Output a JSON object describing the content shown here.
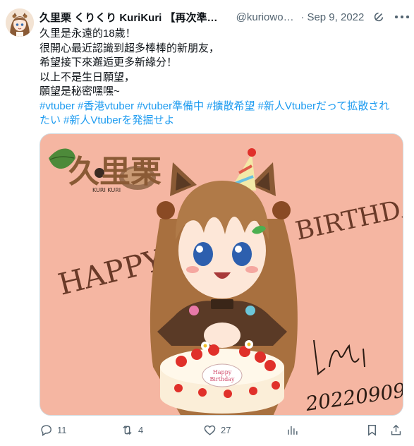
{
  "tweet": {
    "display_name": "久里栗 くりくり KuriKuri 【再次準備…",
    "handle": "@kuriowok…",
    "separator": "·",
    "date": "Sep 9, 2022",
    "text_lines": [
      "久里是永遠的18歲！",
      "很開心最近認識到超多棒棒的新朋友，",
      "希望接下來邂逅更多新緣分！",
      "以上不是生日願望，",
      "願望是秘密嘿嘿~"
    ],
    "hashtag_lines": [
      [
        "#vtuber",
        "#香港vtuber",
        "#vtuber準備中",
        "#擴散希望",
        "#新人Vtuberだって拡散され"
      ],
      [
        "たい",
        "#新人Vtuberを発掘せよ"
      ]
    ]
  },
  "media": {
    "logo_text": "久里栗",
    "logo_subtext": "KURI KURI",
    "happy_text": "HAPPY",
    "birthday_text": "BIRTHDAY",
    "cake_plaque": [
      "Happy",
      "Birthday"
    ],
    "date_signature": "20220909",
    "background_color": "#f5b6a2"
  },
  "actions": {
    "replies": "11",
    "reposts": "4",
    "likes": "27",
    "icons": [
      "reply-icon",
      "repost-icon",
      "like-icon",
      "views-icon",
      "bookmark-icon",
      "share-icon"
    ]
  },
  "colors": {
    "link": "#1d9bf0",
    "secondary_text": "#536471",
    "primary_text": "#0f1419"
  }
}
